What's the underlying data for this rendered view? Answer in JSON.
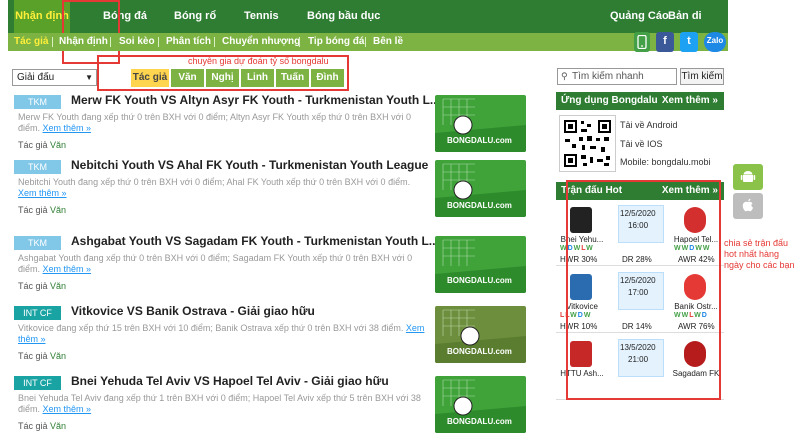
{
  "topnav": {
    "items": [
      "Nhận định",
      "Bóng đá",
      "Bóng rổ",
      "Tennis",
      "Bóng bầu dục"
    ],
    "right": [
      "Quảng Cáo",
      "Bản di động"
    ]
  },
  "subnav": {
    "items": [
      "Tác giả",
      "Nhận định",
      "Soi kèo",
      "Phân tích",
      "Chuyển nhượng",
      "Tip bóng đá",
      "Bên lề"
    ]
  },
  "share_icons": [
    "phone-icon",
    "facebook-icon",
    "twitter-icon",
    "zalo-icon"
  ],
  "share_labels": {
    "facebook": "f",
    "twitter": "t",
    "zalo": "Zalo"
  },
  "filter": {
    "select_value": "Giải đấu",
    "authors": [
      "Tác giả",
      "Văn",
      "Nghị",
      "Linh",
      "Tuấn",
      "Đình"
    ],
    "annotation": "chuyên gia dự đoán tỷ số bongdalu"
  },
  "articles": [
    {
      "badge": "TKM",
      "title": "Merw FK Youth VS Altyn Asyr FK Youth - Turkmenistan Youth L...",
      "summary": "Merw FK Youth đang xếp thứ 0 trên BXH với 0 điểm; Altyn Asyr FK Youth xếp thứ 0 trên BXH với 0 điểm.",
      "more": "Xem thêm »",
      "author_label": "Tác giả",
      "author": "Văn"
    },
    {
      "badge": "TKM",
      "title": "Nebitchi Youth VS Ahal FK Youth - Turkmenistan Youth League",
      "summary": "Nebitchi Youth đang xếp thứ 0 trên BXH với 0 điểm; Ahal FK Youth xếp thứ 0 trên BXH với 0 điểm.",
      "more": "Xem thêm »",
      "author_label": "Tác giả",
      "author": "Văn"
    },
    {
      "badge": "TKM",
      "title": "Ashgabat Youth VS Sagadam FK Youth - Turkmenistan Youth L...",
      "summary": "Ashgabat Youth đang xếp thứ 0 trên BXH với 0 điểm; Sagadam FK Youth xếp thứ 0 trên BXH với 0 điểm.",
      "more": "Xem thêm »",
      "author_label": "Tác giả",
      "author": "Văn"
    },
    {
      "badge": "INT CF",
      "title": "Vitkovice VS Banik Ostrava - Giải giao hữu",
      "summary": "Vitkovice đang xếp thứ 15 trên BXH với 10 điểm; Banik Ostrava xếp thứ 0 trên BXH với 38 điểm.",
      "more": "Xem thêm »",
      "author_label": "Tác giả",
      "author": "Văn"
    },
    {
      "badge": "INT CF",
      "title": "Bnei Yehuda Tel Aviv VS Hapoel Tel Aviv - Giải giao hữu",
      "summary": "Bnei Yehuda Tel Aviv đang xếp thứ 1 trên BXH với 0 điểm; Hapoel Tel Aviv xếp thứ 5 trên BXH với 38 điểm.",
      "more": "Xem thêm »",
      "author_label": "Tác giả",
      "author": "Văn"
    }
  ],
  "thumb_text": "BONGDALU.com",
  "search": {
    "placeholder": "Tìm kiếm nhanh",
    "button": "Tìm kiếm"
  },
  "app_panel": {
    "title": "Ứng dụng Bongdalu",
    "more": "Xem thêm »",
    "android": "Tải về Android",
    "ios": "Tải về IOS",
    "mobile": "Mobile: bongdalu.mobi"
  },
  "hot_panel": {
    "title": "Trận đấu Hot",
    "more": "Xem thêm »",
    "annotation": "chia sẻ trận đấu hot nhất hàng ngày cho các bạn",
    "matches": [
      {
        "home": "Bnei Yehu...",
        "date": "12/5/2020",
        "time": "16:00",
        "away": "Hapoel Tel...",
        "home_form": [
          "W",
          "D",
          "W",
          "L",
          "W"
        ],
        "away_form": [
          "W",
          "W",
          "D",
          "W",
          "W"
        ],
        "hwr": "HWR 30%",
        "dr": "DR 28%",
        "awr": "AWR 42%"
      },
      {
        "home": "Vitkovice",
        "date": "12/5/2020",
        "time": "17:00",
        "away": "Banik Ostr...",
        "home_form": [
          "L",
          "L",
          "W",
          "D",
          "W"
        ],
        "away_form": [
          "W",
          "W",
          "L",
          "W",
          "D"
        ],
        "hwr": "HWR 10%",
        "dr": "DR 14%",
        "awr": "AWR 76%"
      },
      {
        "home": "HTTU Ash...",
        "date": "13/5/2020",
        "time": "21:00",
        "away": "Sagadam FK",
        "home_form": [],
        "away_form": [],
        "hwr": "",
        "dr": "",
        "awr": ""
      }
    ]
  },
  "side_buttons": [
    "android-icon",
    "apple-icon"
  ]
}
